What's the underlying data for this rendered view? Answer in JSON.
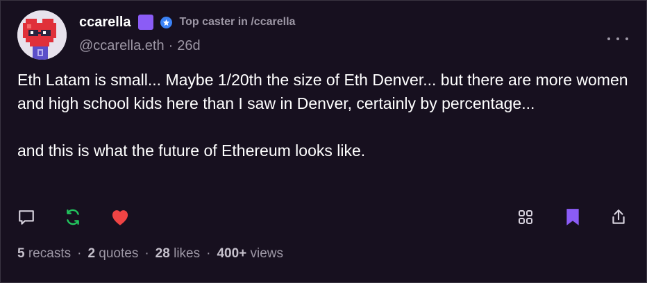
{
  "author": {
    "display_name": "ccarella",
    "username": "@ccarella.eth",
    "time_ago": "26d",
    "separator": "·",
    "caster_label": "Top caster in /ccarella",
    "badge_color": "#8b5cf6",
    "power_badge_color": "#3b82f6",
    "avatar_icon": "heart-pixel-avatar-icon"
  },
  "post": {
    "paragraphs": [
      "Eth Latam is small... Maybe 1/20th the size of Eth Denver... but there are more women and high school kids here than I saw in Denver, certainly by percentage...",
      "and this is what the future of Ethereum looks like."
    ]
  },
  "actions": {
    "reply_icon": "comment-icon",
    "recast_icon": "recast-icon",
    "like_icon": "heart-icon",
    "grid_icon": "grid-icon",
    "bookmark_icon": "bookmark-icon",
    "share_icon": "share-icon",
    "recast_color": "#22c55e",
    "like_color": "#ef4444",
    "bookmark_color": "#8b5cf6"
  },
  "stats": {
    "recasts_count": "5",
    "recasts_label": "recasts",
    "quotes_count": "2",
    "quotes_label": "quotes",
    "likes_count": "28",
    "likes_label": "likes",
    "views_count": "400+",
    "views_label": "views",
    "separator": "·"
  }
}
